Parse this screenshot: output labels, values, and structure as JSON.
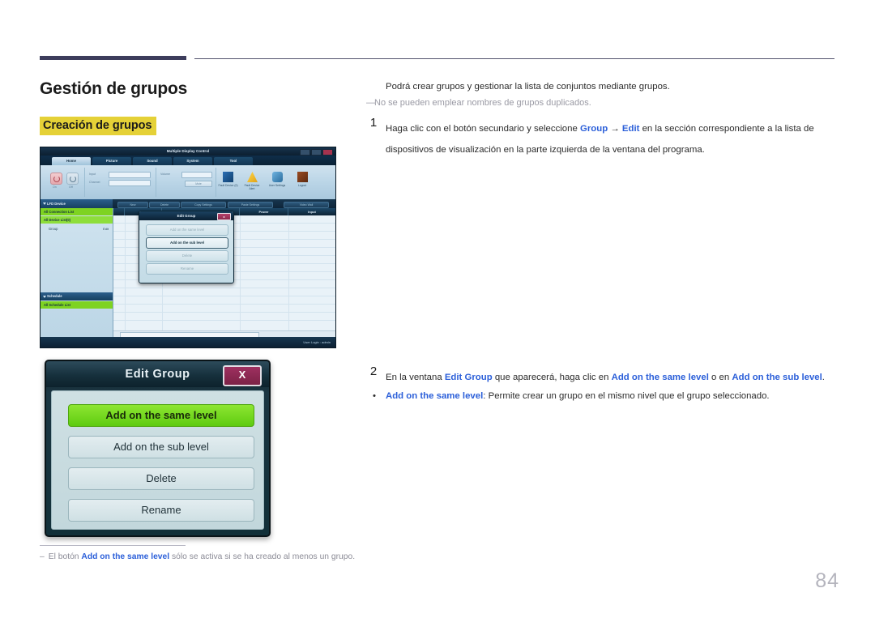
{
  "document": {
    "page_number": "84",
    "title": "Gestión de grupos",
    "subheading": "Creación de grupos"
  },
  "colors": {
    "accent_blue": "#2b5fd9",
    "highlight_yellow": "#e5d137",
    "rule_navy": "#3d3d5c",
    "green_button": "#6ecf1a",
    "close_magenta": "#9e3060"
  },
  "body": {
    "intro": "Podrá crear grupos y gestionar la lista de conjuntos mediante grupos.",
    "note": "No se pueden emplear nombres de grupos duplicados.",
    "steps": [
      {
        "number": "1",
        "parts": [
          {
            "t": "Haga clic con el botón secundario y seleccione ",
            "b": false
          },
          {
            "t": "Group",
            "b": true
          },
          {
            "t": " → ",
            "b": false
          },
          {
            "t": "Edit",
            "b": true
          },
          {
            "t": " en la sección correspondiente a la lista de dispositivos de visualización en la parte izquierda de la ventana del programa.",
            "b": false
          }
        ]
      },
      {
        "number": "2",
        "parts": [
          {
            "t": "En la ventana ",
            "b": false
          },
          {
            "t": "Edit Group",
            "b": true
          },
          {
            "t": " que aparecerá, haga clic en ",
            "b": false
          },
          {
            "t": "Add on the same level",
            "b": true
          },
          {
            "t": " o en ",
            "b": false
          },
          {
            "t": "Add on the sub level",
            "b": true
          },
          {
            "t": ".",
            "b": false
          }
        ]
      }
    ],
    "bullets": [
      {
        "marker": "•",
        "parts": [
          {
            "t": "Add on the same level",
            "b": true
          },
          {
            "t": ": Permite crear un grupo en el mismo nivel que el grupo seleccionado.",
            "b": false
          }
        ]
      }
    ],
    "footnote": {
      "dash": "–",
      "parts": [
        {
          "t": "El botón ",
          "b": false
        },
        {
          "t": "Add on the same level",
          "b": true
        },
        {
          "t": " sólo se activa si se ha creado al menos un grupo.",
          "b": false
        }
      ]
    }
  },
  "mdc_screenshot": {
    "window_title": "Multiple Display Control",
    "window_buttons": [
      "minimize",
      "maximize",
      "close"
    ],
    "help_icon": "help-icon",
    "tabs": [
      {
        "label": "Home",
        "active": true
      },
      {
        "label": "Picture",
        "active": false
      },
      {
        "label": "Sound",
        "active": false
      },
      {
        "label": "System",
        "active": false
      },
      {
        "label": "Tool",
        "active": false
      }
    ],
    "ribbon": {
      "power_on_label": "On",
      "power_off_label": "Off",
      "input_label": "Input",
      "channel_label": "Channel",
      "volume_label": "Volume",
      "mute_label": "Mute",
      "icons": [
        {
          "label": "Fault Device (0)",
          "name": "fault-device-icon"
        },
        {
          "label": "Fault Device Alert",
          "name": "fault-device-alert-icon"
        },
        {
          "label": "User Settings",
          "name": "user-settings-icon"
        },
        {
          "label": "Logout",
          "name": "logout-icon"
        }
      ]
    },
    "toolbar": [
      "New",
      "Delete",
      "Copy Settings",
      "Paste Settings",
      "Video Wall"
    ],
    "sidebar": {
      "lfd_header": "LFD Device",
      "items": [
        {
          "label": "All Connection List",
          "style": "green"
        },
        {
          "label": "All Device List(0)",
          "style": "green2"
        },
        {
          "label": "Group",
          "style": "plain",
          "action": "Edit"
        }
      ],
      "schedule_header": "Schedule",
      "schedule_items": [
        {
          "label": "All Schedule List",
          "style": "green"
        }
      ]
    },
    "grid_headers": [
      "",
      "ID",
      "Set Name",
      "Power",
      "Input"
    ],
    "status_bar": "User Login : admin",
    "inline_dialog": {
      "title": "Edit Group",
      "close_label": "x",
      "buttons": [
        {
          "label": "Add on the same level",
          "selected": false
        },
        {
          "label": "Add on the sub level",
          "selected": true
        },
        {
          "label": "Delete",
          "selected": false
        },
        {
          "label": "Rename",
          "selected": false
        }
      ]
    }
  },
  "edit_group_dialog": {
    "title": "Edit Group",
    "close_label": "X",
    "buttons": [
      {
        "label": "Add on the same level",
        "primary": true
      },
      {
        "label": "Add on the sub level",
        "primary": false
      },
      {
        "label": "Delete",
        "primary": false
      },
      {
        "label": "Rename",
        "primary": false
      }
    ]
  }
}
